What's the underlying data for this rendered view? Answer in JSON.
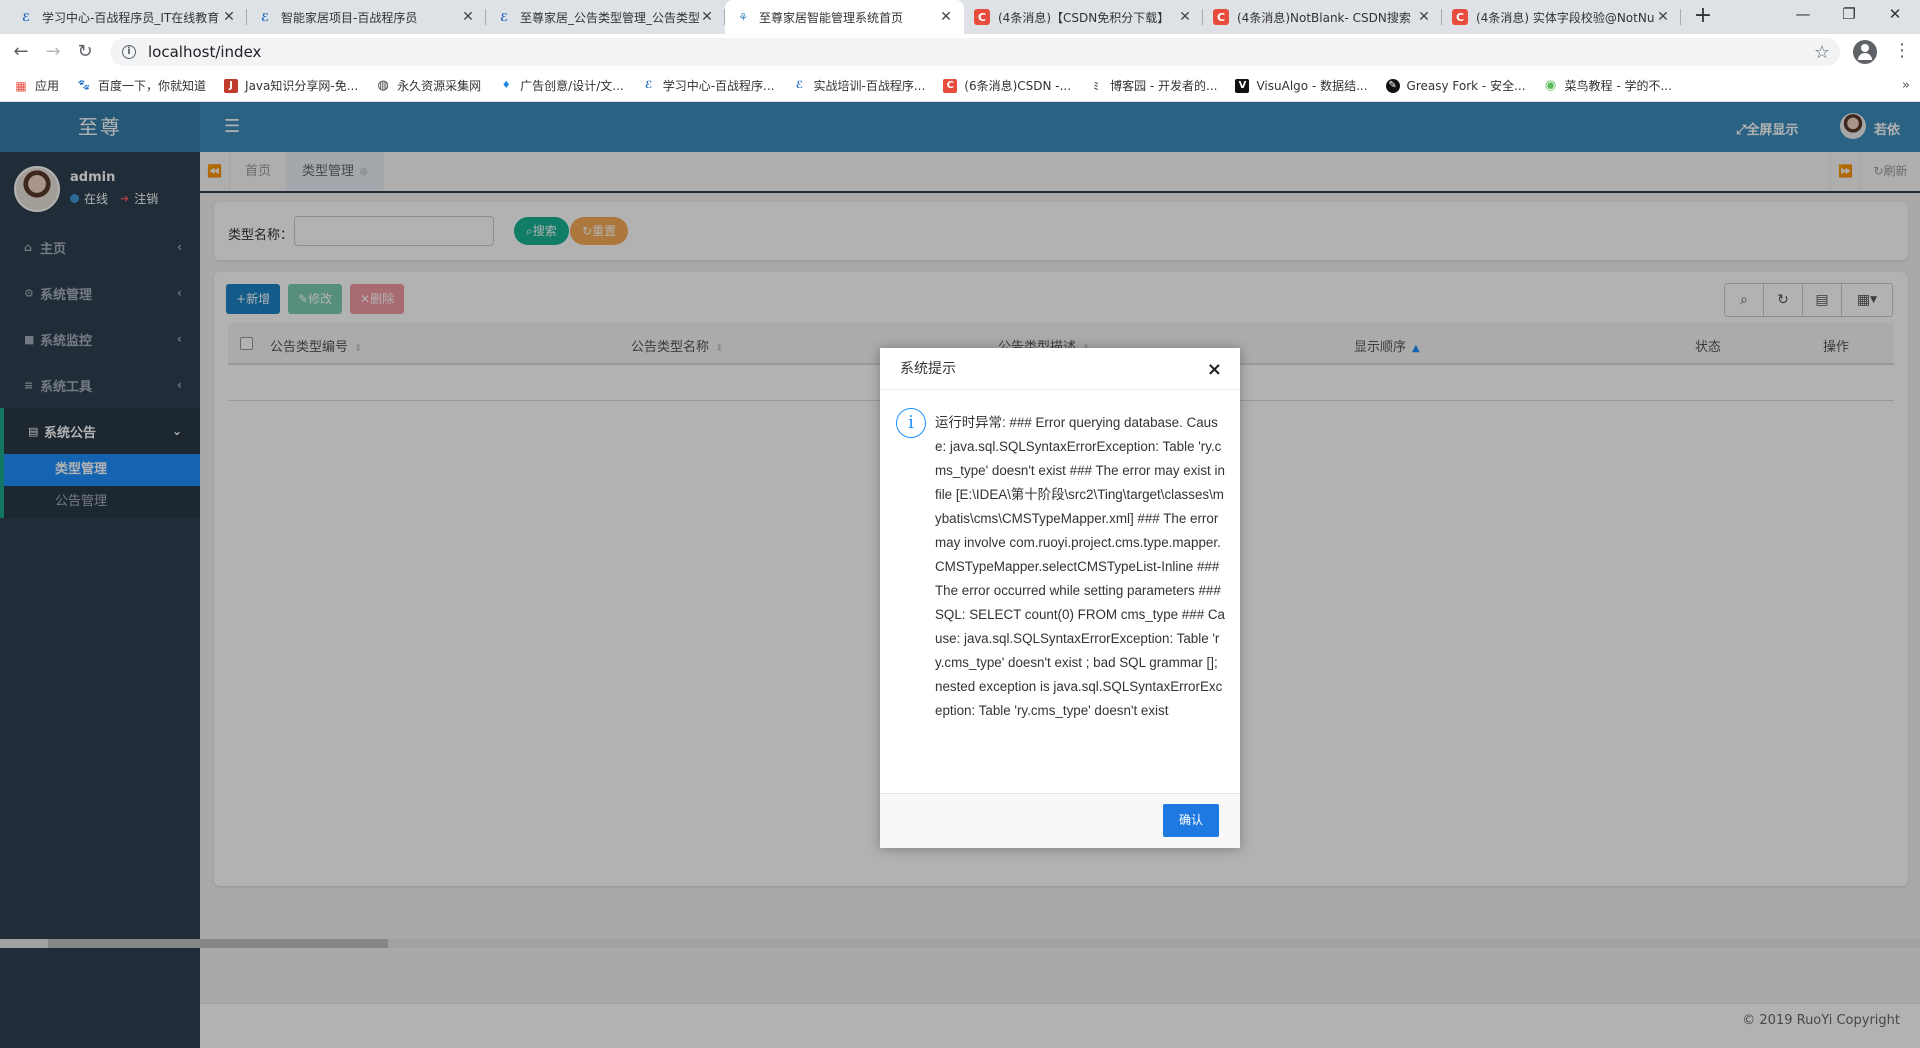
{
  "browser": {
    "tabs": [
      {
        "title": "学习中心-百战程序员_IT在线教育",
        "icon": "e-icon",
        "color": "#1565c0"
      },
      {
        "title": "智能家居项目-百战程序员",
        "icon": "e-icon",
        "color": "#1565c0"
      },
      {
        "title": "至尊家居_公告类型管理_公告类型",
        "icon": "e-icon",
        "color": "#1565c0"
      },
      {
        "title": "至尊家居智能管理系统首页",
        "icon": "lotus-icon",
        "color": "#3c8dbc",
        "active": true
      },
      {
        "title": "(4条消息)【CSDN免积分下载】",
        "icon": "csdn-icon",
        "color": "#e74c3c"
      },
      {
        "title": "(4条消息)NotBlank- CSDN搜索",
        "icon": "csdn-icon",
        "color": "#e74c3c"
      },
      {
        "title": "(4条消息) 实体字段校验@NotNu",
        "icon": "csdn-icon",
        "color": "#e74c3c"
      }
    ],
    "url": "localhost/index",
    "bookmarks": [
      {
        "label": "应用",
        "icon": "apps-icon"
      },
      {
        "label": "百度一下，你就知道",
        "icon": "baidu-icon"
      },
      {
        "label": "Java知识分享网-免...",
        "icon": "j-icon"
      },
      {
        "label": "永久资源采集网",
        "icon": "globe-icon"
      },
      {
        "label": "广告创意/设计/文...",
        "icon": "drop-icon"
      },
      {
        "label": "学习中心-百战程序...",
        "icon": "e-icon"
      },
      {
        "label": "实战培训-百战程序...",
        "icon": "e-icon"
      },
      {
        "label": "(6条消息)CSDN -...",
        "icon": "csdn-icon"
      },
      {
        "label": "博客园 - 开发者的...",
        "icon": "cnblogs-icon"
      },
      {
        "label": "VisuAlgo - 数据结...",
        "icon": "visualgo-icon"
      },
      {
        "label": "Greasy Fork - 安全...",
        "icon": "greasyfork-icon"
      },
      {
        "label": "菜鸟教程 - 学的不...",
        "icon": "runoob-icon"
      }
    ]
  },
  "app": {
    "logo": "至尊",
    "user": {
      "name": "admin",
      "status": "在线",
      "logout": "注销"
    },
    "menu": [
      {
        "label": "主页",
        "icon": "home-icon"
      },
      {
        "label": "系统管理",
        "icon": "gear-icon"
      },
      {
        "label": "系统监控",
        "icon": "video-icon"
      },
      {
        "label": "系统工具",
        "icon": "bars-icon"
      },
      {
        "label": "系统公告",
        "icon": "clipboard-icon",
        "open": true
      }
    ],
    "submenu": [
      {
        "label": "类型管理",
        "active": true
      },
      {
        "label": "公告管理"
      }
    ],
    "topbar": {
      "fullscreen": "全屏显示",
      "username": "若依"
    },
    "page_tabs": [
      {
        "label": "首页"
      },
      {
        "label": "类型管理",
        "active": true
      }
    ],
    "refresh": "刷新",
    "search": {
      "label": "类型名称：",
      "value": "",
      "search_btn": "搜索",
      "reset_btn": "重置"
    },
    "toolbar": {
      "add": "新增",
      "edit": "修改",
      "delete": "删除"
    },
    "columns": [
      "公告类型编号",
      "公告类型名称",
      "公告类型描述",
      "显示顺序",
      "状态",
      "操作"
    ],
    "footer": "© 2019 RuoYi Copyright"
  },
  "dialog": {
    "title": "系统提示",
    "message": "运行时异常: ### Error querying database. Cause: java.sql.SQLSyntaxErrorException: Table 'ry.cms_type' doesn't exist ### The error may exist in file [E:\\IDEA\\第十阶段\\src2\\Ting\\target\\classes\\mybatis\\cms\\CMSTypeMapper.xml] ### The error may involve com.ruoyi.project.cms.type.mapper.CMSTypeMapper.selectCMSTypeList-Inline ### The error occurred while setting parameters ### SQL: SELECT count(0) FROM cms_type ### Cause: java.sql.SQLSyntaxErrorException: Table 'ry.cms_type' doesn't exist ; bad SQL grammar []; nested exception is java.sql.SQLSyntaxErrorException: Table 'ry.cms_type' doesn't exist",
    "confirm": "确认"
  },
  "colors": {
    "sidebar": "#2f4050",
    "topbar": "#3c8dbc",
    "primary": "#1e90ff",
    "success": "#1ab394",
    "warning": "#f8ac59",
    "danger": "#ed5565"
  }
}
